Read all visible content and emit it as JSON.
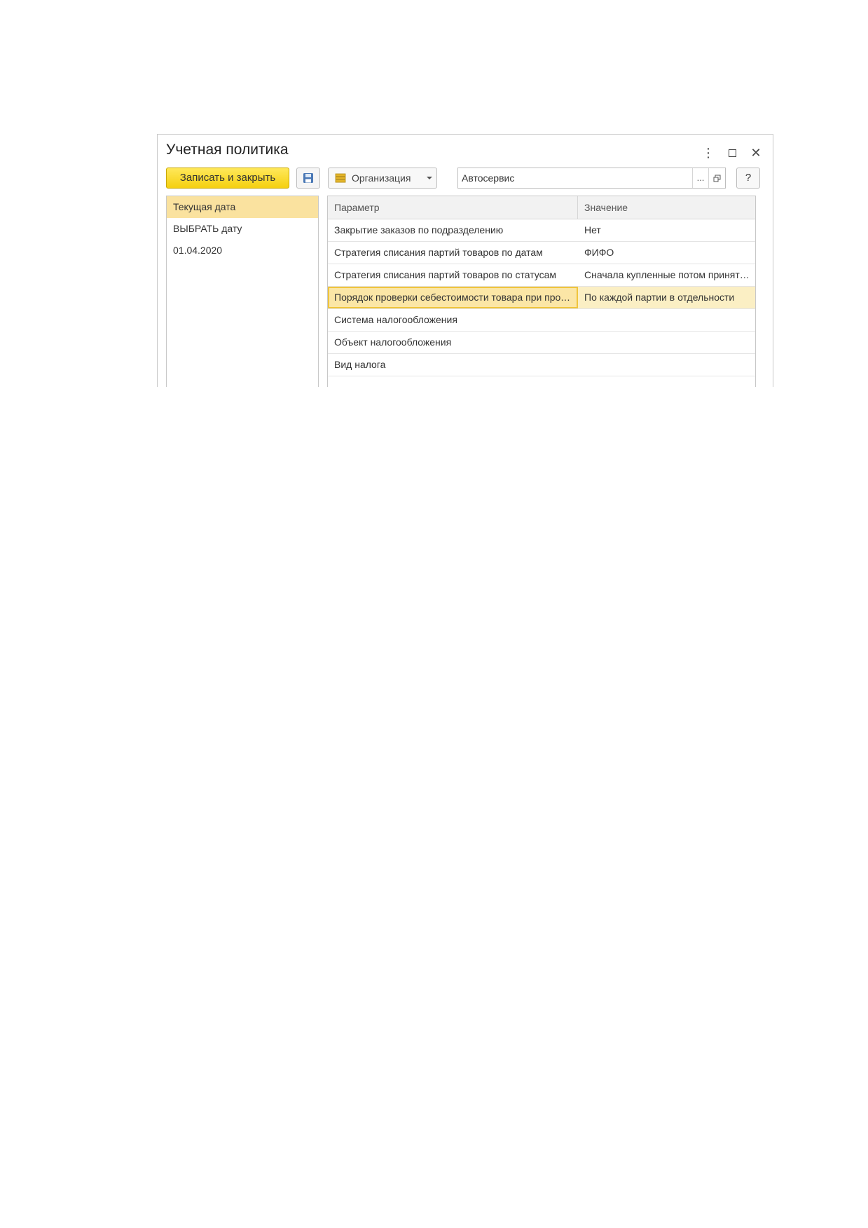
{
  "window": {
    "title": "Учетная политика",
    "controls": {
      "menu": "⋮",
      "maximize": "",
      "close": "✕"
    }
  },
  "toolbar": {
    "save_close_label": "Записать и закрыть",
    "save_icon": "floppy-disk-icon",
    "org_label": "Организация",
    "org_value": "Автосервис",
    "dots_label": "...",
    "help_label": "?"
  },
  "left_panel": {
    "items": [
      {
        "label": "Текущая дата",
        "selected": true
      },
      {
        "label": "ВЫБРАТЬ дату",
        "selected": false
      },
      {
        "label": "01.04.2020",
        "selected": false
      }
    ]
  },
  "grid": {
    "columns": [
      "Параметр",
      "Значение"
    ],
    "rows": [
      {
        "param": "Закрытие заказов по подразделению",
        "value": "Нет"
      },
      {
        "param": "Стратегия списания партий товаров по датам",
        "value": "ФИФО"
      },
      {
        "param": "Стратегия списания партий товаров по статусам",
        "value": "Сначала купленные потом принятые на комиссию"
      },
      {
        "param": "Порядок проверки себестоимости товара при продаже",
        "value": "По каждой партии в отдельности",
        "selected": true
      },
      {
        "param": "Система налогообложения",
        "value": ""
      },
      {
        "param": "Объект налогообложения",
        "value": ""
      },
      {
        "param": "Вид налога",
        "value": ""
      }
    ]
  },
  "colors": {
    "accent": "#f5d010",
    "selected_row": "#fbefc4",
    "selected_left": "#fae29f"
  }
}
